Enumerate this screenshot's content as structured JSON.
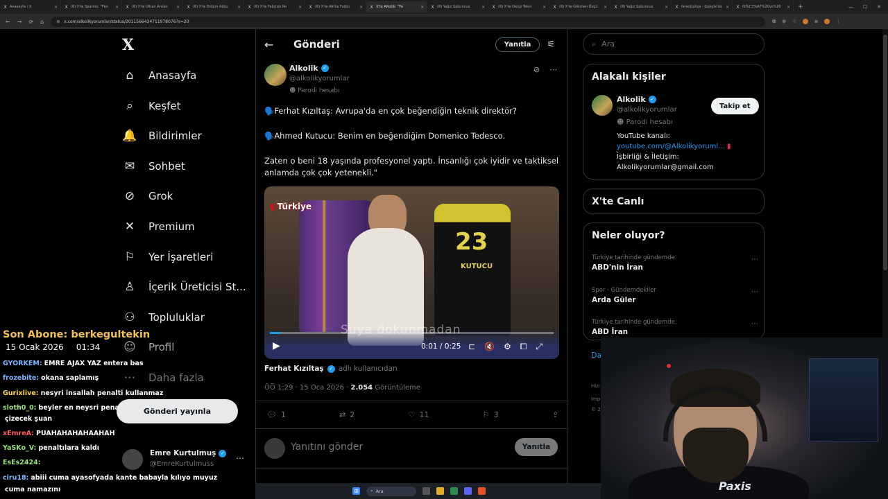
{
  "browser": {
    "tabs": [
      {
        "label": "Anasayfa / X"
      },
      {
        "label": "(6) X'te Sparmo: \"Fen"
      },
      {
        "label": "(6) X'te Ulhan Arslan"
      },
      {
        "label": "(6) X'te Erdem Akbu"
      },
      {
        "label": "(6) X'te Fabrizio Ro"
      },
      {
        "label": "(6) X'te Afrika Futbo"
      },
      {
        "label": "X'te Alkolik: \"Fe",
        "active": true
      },
      {
        "label": "(6) Yağız Sabuncuo"
      },
      {
        "label": "(6) X'te Deniz Tekin"
      },
      {
        "label": "(6) X'te Gökmen Özgü"
      },
      {
        "label": "(6) Yağız Sabuncuo"
      },
      {
        "label": "fenerbahçe - Google'da"
      },
      {
        "label": "fb%C3%A7%20vs%20"
      }
    ],
    "url": "x.com/alkolikyorumlar/status/2011566434711978076?s=20",
    "new_tab": "+"
  },
  "nav": {
    "logo": "X",
    "items": [
      {
        "label": "Anasayfa",
        "icon": "home-icon",
        "glyph": "⌂"
      },
      {
        "label": "Keşfet",
        "icon": "search-icon",
        "glyph": "⌕"
      },
      {
        "label": "Bildirimler",
        "icon": "bell-icon",
        "glyph": "🔔"
      },
      {
        "label": "Sohbet",
        "icon": "mail-icon",
        "glyph": "✉"
      },
      {
        "label": "Grok",
        "icon": "grok-icon",
        "glyph": "⊘"
      },
      {
        "label": "Premium",
        "icon": "x-premium-icon",
        "glyph": "✕"
      },
      {
        "label": "Yer İşaretleri",
        "icon": "bookmark-icon",
        "glyph": "⚐"
      },
      {
        "label": "İçerik Üreticisi St...",
        "icon": "creator-studio-icon",
        "glyph": "♙"
      },
      {
        "label": "Topluluklar",
        "icon": "communities-icon",
        "glyph": "⚇"
      },
      {
        "label": "Profil",
        "icon": "profile-icon",
        "glyph": "☺"
      },
      {
        "label": "Daha fazla",
        "icon": "more-circle-icon",
        "glyph": "⋯"
      }
    ]
  },
  "main": {
    "title": "Gönderi",
    "reply_top": "Yanıtla",
    "author": {
      "name": "Alkolik",
      "handle": "@alkolikyorumlar",
      "parody": "Parodi hesabı"
    },
    "paragraphs": [
      "🗣️Ferhat Kızıltaş: Avrupa'da en çok beğendiğin teknik direktör?",
      "🗣️Ahmed Kutucu: Benim en beğendiğim Domenico Tedesco.",
      "Zaten o beni  18 yaşında profesyonel yaptı. İnsanlığı çok iyidir ve taktiksel anlamda çok çok yetenekli.\""
    ],
    "video": {
      "brand": "Türkiye",
      "jersey_number": "23",
      "jersey_name": "KUTUCU",
      "subtitle": "Suya dokunmadan",
      "time": "0:01 / 0:25",
      "progress": 0.04
    },
    "byline_name": "Ferhat Kızıltaş",
    "byline_note": "adlı kullanıcıdan",
    "meta_time": "ÖÖ 1:29 · 15 Oca 2026 · ",
    "meta_views": "2.054",
    "meta_views_label": " Görüntüleme",
    "stats": {
      "replies": "1",
      "reposts": "2",
      "likes": "11",
      "bookmarks": "3"
    },
    "reply_placeholder": "Yanıtını gönder",
    "reply_button": "Yanıtla"
  },
  "right": {
    "search_placeholder": "Ara",
    "related_title": "Alakalı kişiler",
    "related": {
      "name": "Alkolik",
      "handle": "@alkolikyorumlar",
      "parody": "Parodi hesabı",
      "follow": "Takip et",
      "bio_line1": "YouTube kanalı:",
      "bio_link": "youtube.com/@Alkolikyoruml...",
      "bio_line3": "İşbirliği & İletişim:",
      "bio_line4": "Alkolikyorumlar@gmail.com"
    },
    "live_title": "X'te Canlı",
    "trends_title": "Neler oluyor?",
    "trends": [
      {
        "context": "Türkiye tarihinde gündemde",
        "name": "ABD'nin İran"
      },
      {
        "context": "Spor · Gündemdekiler",
        "name": "Arda Güler"
      },
      {
        "context": "Türkiye tarihinde gündemde",
        "name": "ABD İran"
      }
    ],
    "partial_link": "Da",
    "footer": [
      "Hizı",
      "Imp",
      "© 2"
    ]
  },
  "stream": {
    "last_sub": "Son Abone: berkegultekin",
    "date": "15 Ocak 2026",
    "clock": "01:34",
    "chat": [
      {
        "user": "GYORKEM:",
        "msg": "EMRE AJAX YAZ entera bas",
        "color": "#7fb3ff"
      },
      {
        "user": "frozebite:",
        "msg": "okana saplamış",
        "color": "#7fb3ff"
      },
      {
        "user": "Gurixlive:",
        "msg": "nesyri insallah penalti kullanmaz",
        "color": "#ffd84a"
      },
      {
        "user": "sloth0_0:",
        "msg": "beyler en neysri penaltı atarsa kademimizi",
        "color": "#9be07b"
      },
      {
        "user": "",
        "msg": "çizecek şuan",
        "color": "#fff"
      },
      {
        "user": "xEmreA:",
        "msg": "PUAHAHAHAHAAHAH",
        "color": "#ff5c5c"
      },
      {
        "user": "YaSKo_V:",
        "msg": "penaltılara kaldı",
        "color": "#9be07b"
      },
      {
        "user": "EsEs2424:",
        "msg": "",
        "color": "#9be07b"
      },
      {
        "user": "ciru18:",
        "msg": "abiii cuma ayasofyada kante babayla kılıyo muyuz",
        "color": "#7fb3ff"
      },
      {
        "user": "",
        "msg": "cuma namazını",
        "color": "#fff"
      }
    ],
    "toast": "Gönderi yayınla",
    "account": {
      "name": "Emre Kurtulmuş",
      "handle": "@EmreKurtulmuss"
    },
    "cam_logo": "Paxis"
  },
  "taskbar": {
    "search": "Ara"
  },
  "colors": {
    "accent": "#1d9bf0",
    "background": "#000000",
    "border": "#2f3336",
    "sub_text": "#71767b"
  }
}
